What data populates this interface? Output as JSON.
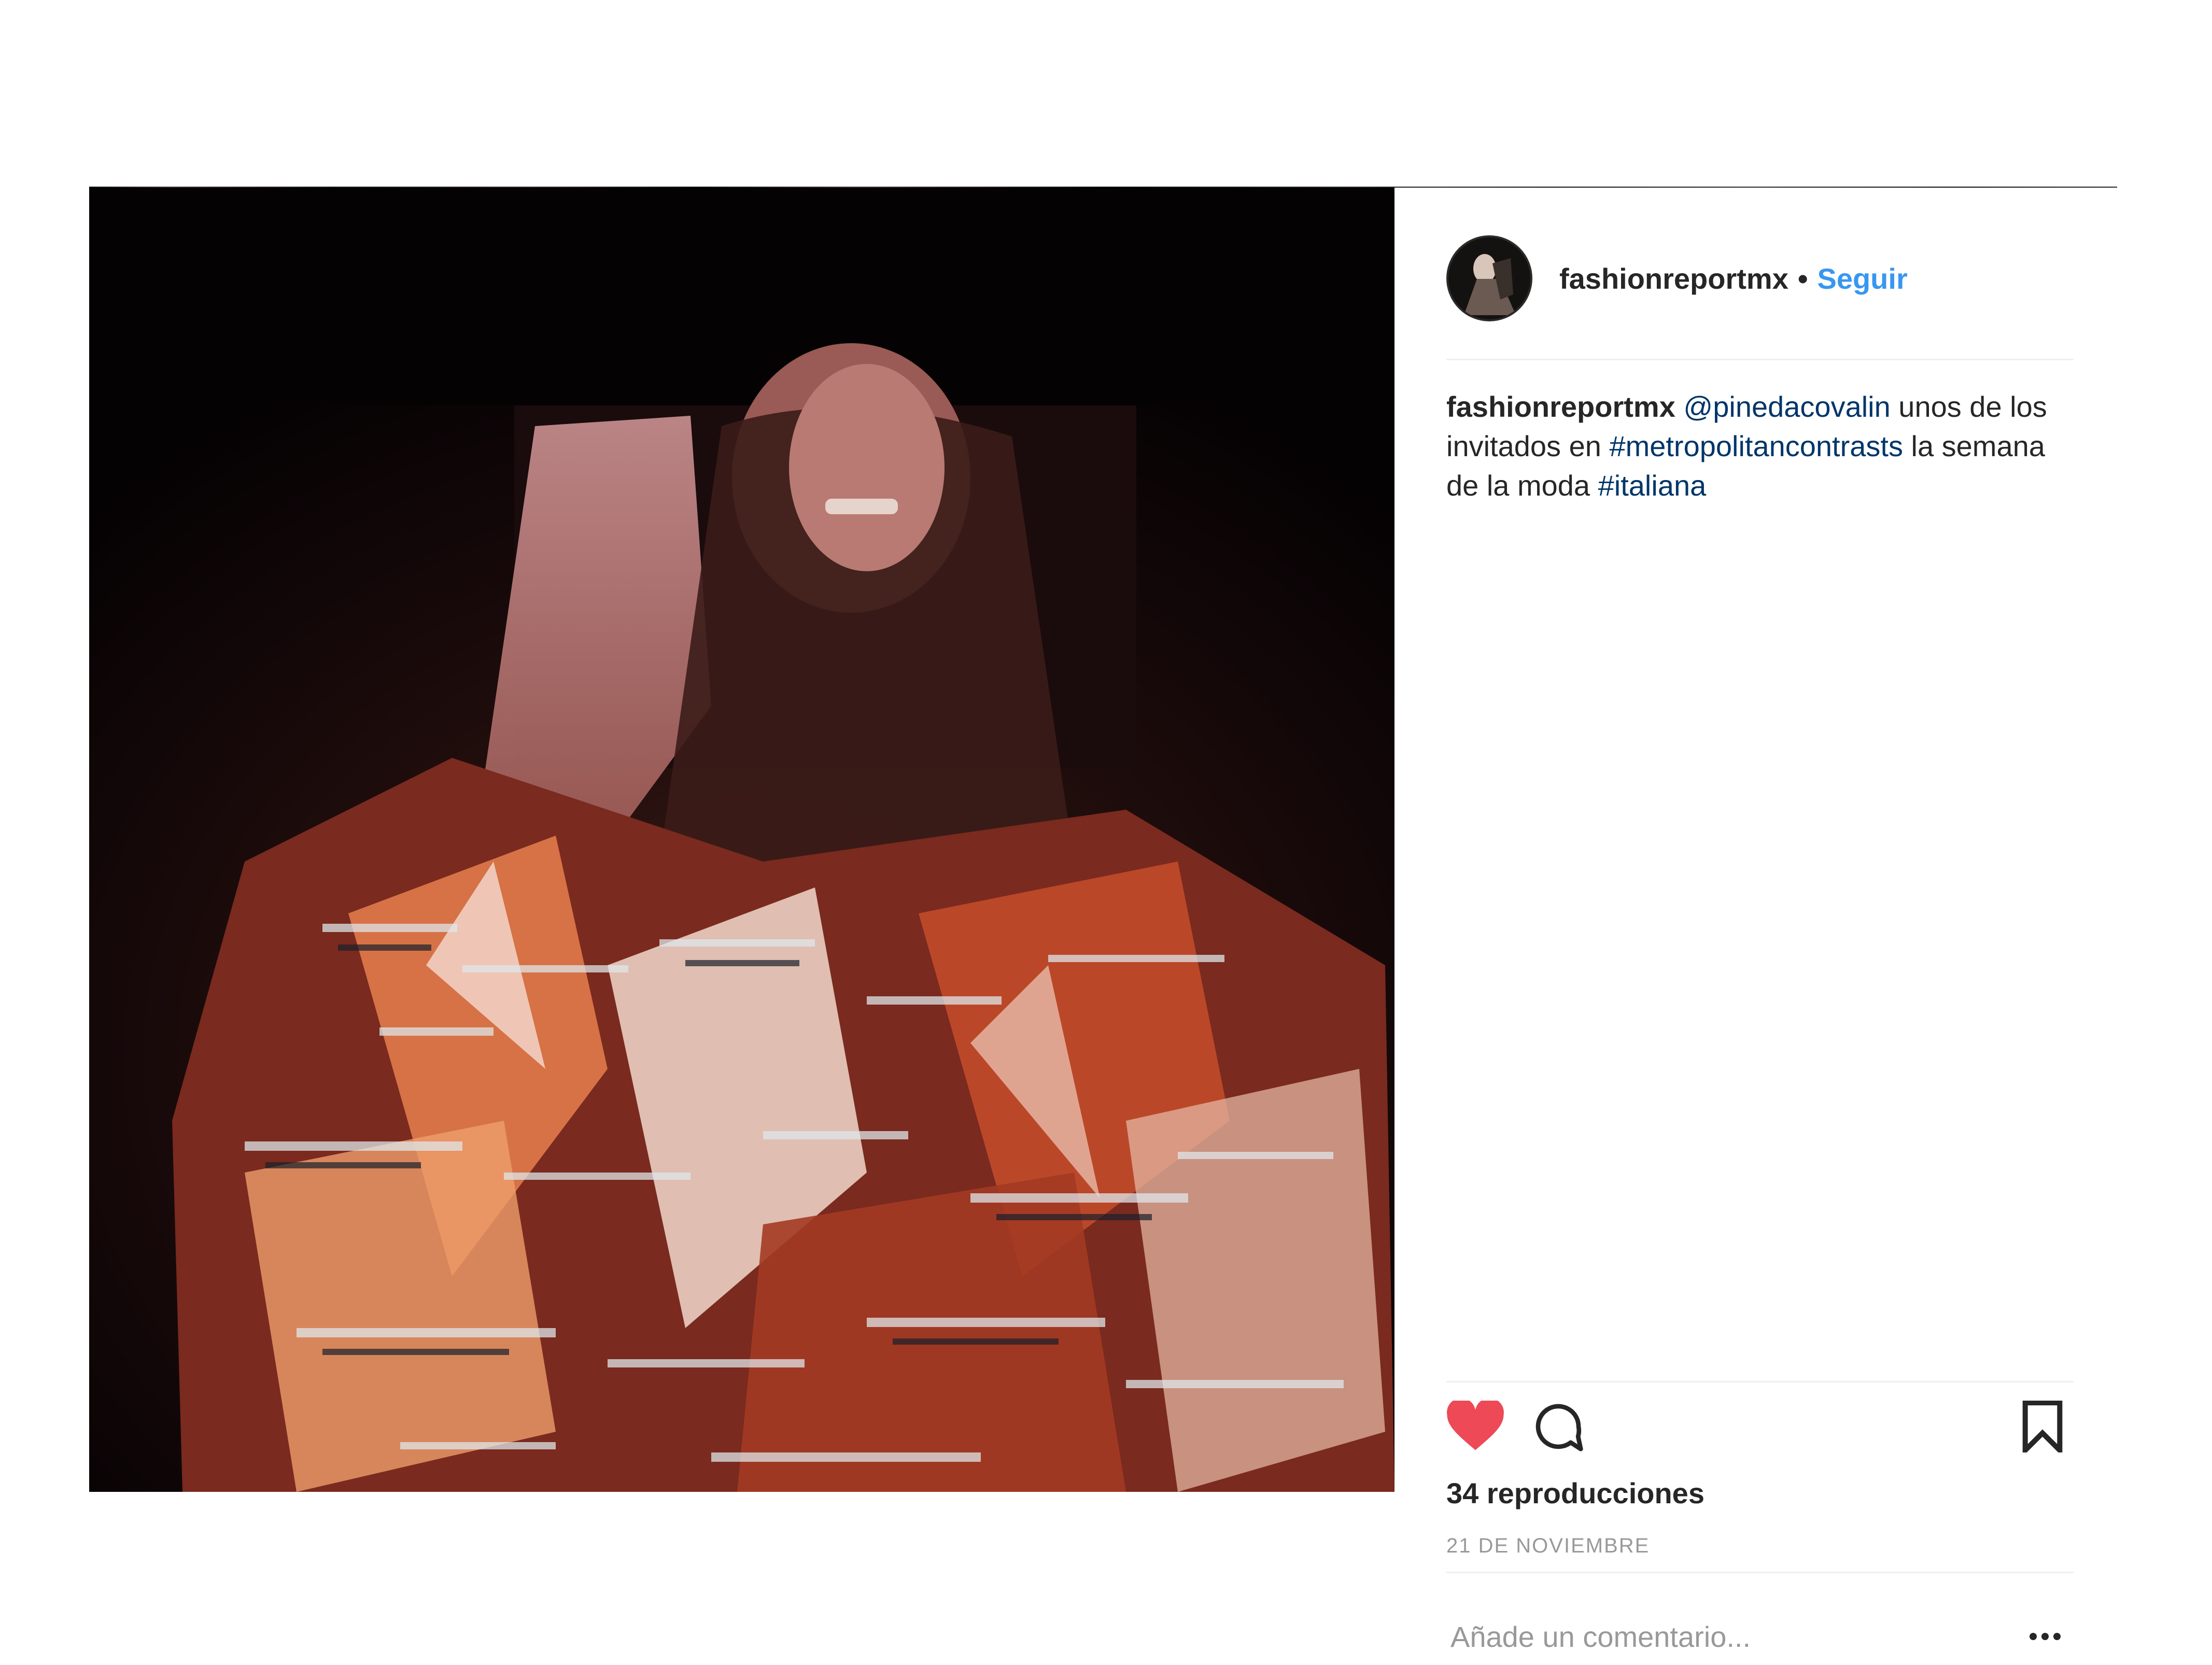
{
  "post": {
    "username": "fashionreportmx",
    "separator": "•",
    "follow_label": "Seguir",
    "caption": {
      "username": "fashionreportmx",
      "mention": "@pinedacovalin",
      "text_1": " unos de los invitados en ",
      "hashtag_1": "#metropolitancontrasts",
      "text_2": " la semana de la moda ",
      "hashtag_2": "#italiana"
    },
    "views": "34 reproducciones",
    "date": "21 DE NOVIEMBRE",
    "comment_placeholder": "Añade un comentario...",
    "icons": {
      "like": "heart-icon",
      "comment": "comment-icon",
      "save": "bookmark-icon",
      "more": "more-options-icon"
    },
    "colors": {
      "like": "#ed4956",
      "follow": "#3897f0",
      "link": "#003569"
    }
  }
}
